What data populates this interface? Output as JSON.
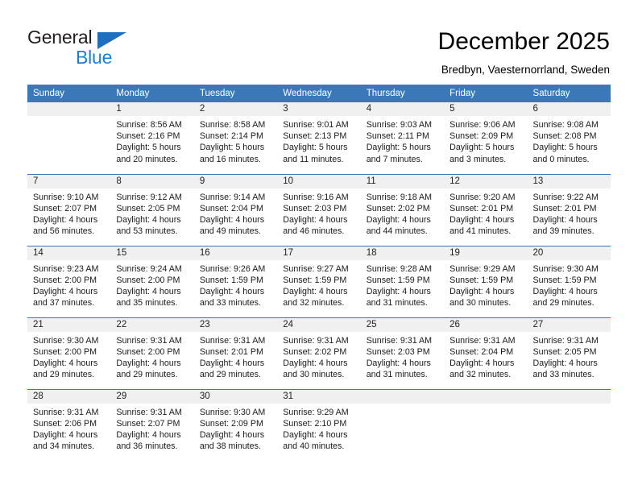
{
  "brand": {
    "name_top": "General",
    "name_bottom": "Blue",
    "triangle_color": "#1f6fc0",
    "blue_text_color": "#1f7dd0"
  },
  "header": {
    "title": "December 2025",
    "subtitle": "Bredbyn, Vaesternorrland, Sweden"
  },
  "theme": {
    "header_blue": "#3b78ba",
    "daynum_gray": "#f0f0f0",
    "separator_blue": "#3b78ba"
  },
  "calendar": {
    "weekday_headers": [
      "Sunday",
      "Monday",
      "Tuesday",
      "Wednesday",
      "Thursday",
      "Friday",
      "Saturday"
    ],
    "weeks": [
      [
        {
          "day": "",
          "blank": true,
          "sunrise": "",
          "sunset": "",
          "daylight_line1": "",
          "daylight_line2": ""
        },
        {
          "day": "1",
          "blank": false,
          "sunrise": "Sunrise: 8:56 AM",
          "sunset": "Sunset: 2:16 PM",
          "daylight_line1": "Daylight: 5 hours",
          "daylight_line2": "and 20 minutes."
        },
        {
          "day": "2",
          "blank": false,
          "sunrise": "Sunrise: 8:58 AM",
          "sunset": "Sunset: 2:14 PM",
          "daylight_line1": "Daylight: 5 hours",
          "daylight_line2": "and 16 minutes."
        },
        {
          "day": "3",
          "blank": false,
          "sunrise": "Sunrise: 9:01 AM",
          "sunset": "Sunset: 2:13 PM",
          "daylight_line1": "Daylight: 5 hours",
          "daylight_line2": "and 11 minutes."
        },
        {
          "day": "4",
          "blank": false,
          "sunrise": "Sunrise: 9:03 AM",
          "sunset": "Sunset: 2:11 PM",
          "daylight_line1": "Daylight: 5 hours",
          "daylight_line2": "and 7 minutes."
        },
        {
          "day": "5",
          "blank": false,
          "sunrise": "Sunrise: 9:06 AM",
          "sunset": "Sunset: 2:09 PM",
          "daylight_line1": "Daylight: 5 hours",
          "daylight_line2": "and 3 minutes."
        },
        {
          "day": "6",
          "blank": false,
          "sunrise": "Sunrise: 9:08 AM",
          "sunset": "Sunset: 2:08 PM",
          "daylight_line1": "Daylight: 5 hours",
          "daylight_line2": "and 0 minutes."
        }
      ],
      [
        {
          "day": "7",
          "blank": false,
          "sunrise": "Sunrise: 9:10 AM",
          "sunset": "Sunset: 2:07 PM",
          "daylight_line1": "Daylight: 4 hours",
          "daylight_line2": "and 56 minutes."
        },
        {
          "day": "8",
          "blank": false,
          "sunrise": "Sunrise: 9:12 AM",
          "sunset": "Sunset: 2:05 PM",
          "daylight_line1": "Daylight: 4 hours",
          "daylight_line2": "and 53 minutes."
        },
        {
          "day": "9",
          "blank": false,
          "sunrise": "Sunrise: 9:14 AM",
          "sunset": "Sunset: 2:04 PM",
          "daylight_line1": "Daylight: 4 hours",
          "daylight_line2": "and 49 minutes."
        },
        {
          "day": "10",
          "blank": false,
          "sunrise": "Sunrise: 9:16 AM",
          "sunset": "Sunset: 2:03 PM",
          "daylight_line1": "Daylight: 4 hours",
          "daylight_line2": "and 46 minutes."
        },
        {
          "day": "11",
          "blank": false,
          "sunrise": "Sunrise: 9:18 AM",
          "sunset": "Sunset: 2:02 PM",
          "daylight_line1": "Daylight: 4 hours",
          "daylight_line2": "and 44 minutes."
        },
        {
          "day": "12",
          "blank": false,
          "sunrise": "Sunrise: 9:20 AM",
          "sunset": "Sunset: 2:01 PM",
          "daylight_line1": "Daylight: 4 hours",
          "daylight_line2": "and 41 minutes."
        },
        {
          "day": "13",
          "blank": false,
          "sunrise": "Sunrise: 9:22 AM",
          "sunset": "Sunset: 2:01 PM",
          "daylight_line1": "Daylight: 4 hours",
          "daylight_line2": "and 39 minutes."
        }
      ],
      [
        {
          "day": "14",
          "blank": false,
          "sunrise": "Sunrise: 9:23 AM",
          "sunset": "Sunset: 2:00 PM",
          "daylight_line1": "Daylight: 4 hours",
          "daylight_line2": "and 37 minutes."
        },
        {
          "day": "15",
          "blank": false,
          "sunrise": "Sunrise: 9:24 AM",
          "sunset": "Sunset: 2:00 PM",
          "daylight_line1": "Daylight: 4 hours",
          "daylight_line2": "and 35 minutes."
        },
        {
          "day": "16",
          "blank": false,
          "sunrise": "Sunrise: 9:26 AM",
          "sunset": "Sunset: 1:59 PM",
          "daylight_line1": "Daylight: 4 hours",
          "daylight_line2": "and 33 minutes."
        },
        {
          "day": "17",
          "blank": false,
          "sunrise": "Sunrise: 9:27 AM",
          "sunset": "Sunset: 1:59 PM",
          "daylight_line1": "Daylight: 4 hours",
          "daylight_line2": "and 32 minutes."
        },
        {
          "day": "18",
          "blank": false,
          "sunrise": "Sunrise: 9:28 AM",
          "sunset": "Sunset: 1:59 PM",
          "daylight_line1": "Daylight: 4 hours",
          "daylight_line2": "and 31 minutes."
        },
        {
          "day": "19",
          "blank": false,
          "sunrise": "Sunrise: 9:29 AM",
          "sunset": "Sunset: 1:59 PM",
          "daylight_line1": "Daylight: 4 hours",
          "daylight_line2": "and 30 minutes."
        },
        {
          "day": "20",
          "blank": false,
          "sunrise": "Sunrise: 9:30 AM",
          "sunset": "Sunset: 1:59 PM",
          "daylight_line1": "Daylight: 4 hours",
          "daylight_line2": "and 29 minutes."
        }
      ],
      [
        {
          "day": "21",
          "blank": false,
          "sunrise": "Sunrise: 9:30 AM",
          "sunset": "Sunset: 2:00 PM",
          "daylight_line1": "Daylight: 4 hours",
          "daylight_line2": "and 29 minutes."
        },
        {
          "day": "22",
          "blank": false,
          "sunrise": "Sunrise: 9:31 AM",
          "sunset": "Sunset: 2:00 PM",
          "daylight_line1": "Daylight: 4 hours",
          "daylight_line2": "and 29 minutes."
        },
        {
          "day": "23",
          "blank": false,
          "sunrise": "Sunrise: 9:31 AM",
          "sunset": "Sunset: 2:01 PM",
          "daylight_line1": "Daylight: 4 hours",
          "daylight_line2": "and 29 minutes."
        },
        {
          "day": "24",
          "blank": false,
          "sunrise": "Sunrise: 9:31 AM",
          "sunset": "Sunset: 2:02 PM",
          "daylight_line1": "Daylight: 4 hours",
          "daylight_line2": "and 30 minutes."
        },
        {
          "day": "25",
          "blank": false,
          "sunrise": "Sunrise: 9:31 AM",
          "sunset": "Sunset: 2:03 PM",
          "daylight_line1": "Daylight: 4 hours",
          "daylight_line2": "and 31 minutes."
        },
        {
          "day": "26",
          "blank": false,
          "sunrise": "Sunrise: 9:31 AM",
          "sunset": "Sunset: 2:04 PM",
          "daylight_line1": "Daylight: 4 hours",
          "daylight_line2": "and 32 minutes."
        },
        {
          "day": "27",
          "blank": false,
          "sunrise": "Sunrise: 9:31 AM",
          "sunset": "Sunset: 2:05 PM",
          "daylight_line1": "Daylight: 4 hours",
          "daylight_line2": "and 33 minutes."
        }
      ],
      [
        {
          "day": "28",
          "blank": false,
          "sunrise": "Sunrise: 9:31 AM",
          "sunset": "Sunset: 2:06 PM",
          "daylight_line1": "Daylight: 4 hours",
          "daylight_line2": "and 34 minutes."
        },
        {
          "day": "29",
          "blank": false,
          "sunrise": "Sunrise: 9:31 AM",
          "sunset": "Sunset: 2:07 PM",
          "daylight_line1": "Daylight: 4 hours",
          "daylight_line2": "and 36 minutes."
        },
        {
          "day": "30",
          "blank": false,
          "sunrise": "Sunrise: 9:30 AM",
          "sunset": "Sunset: 2:09 PM",
          "daylight_line1": "Daylight: 4 hours",
          "daylight_line2": "and 38 minutes."
        },
        {
          "day": "31",
          "blank": false,
          "sunrise": "Sunrise: 9:29 AM",
          "sunset": "Sunset: 2:10 PM",
          "daylight_line1": "Daylight: 4 hours",
          "daylight_line2": "and 40 minutes."
        },
        {
          "day": "",
          "blank": true,
          "sunrise": "",
          "sunset": "",
          "daylight_line1": "",
          "daylight_line2": ""
        },
        {
          "day": "",
          "blank": true,
          "sunrise": "",
          "sunset": "",
          "daylight_line1": "",
          "daylight_line2": ""
        },
        {
          "day": "",
          "blank": true,
          "sunrise": "",
          "sunset": "",
          "daylight_line1": "",
          "daylight_line2": ""
        }
      ]
    ]
  }
}
